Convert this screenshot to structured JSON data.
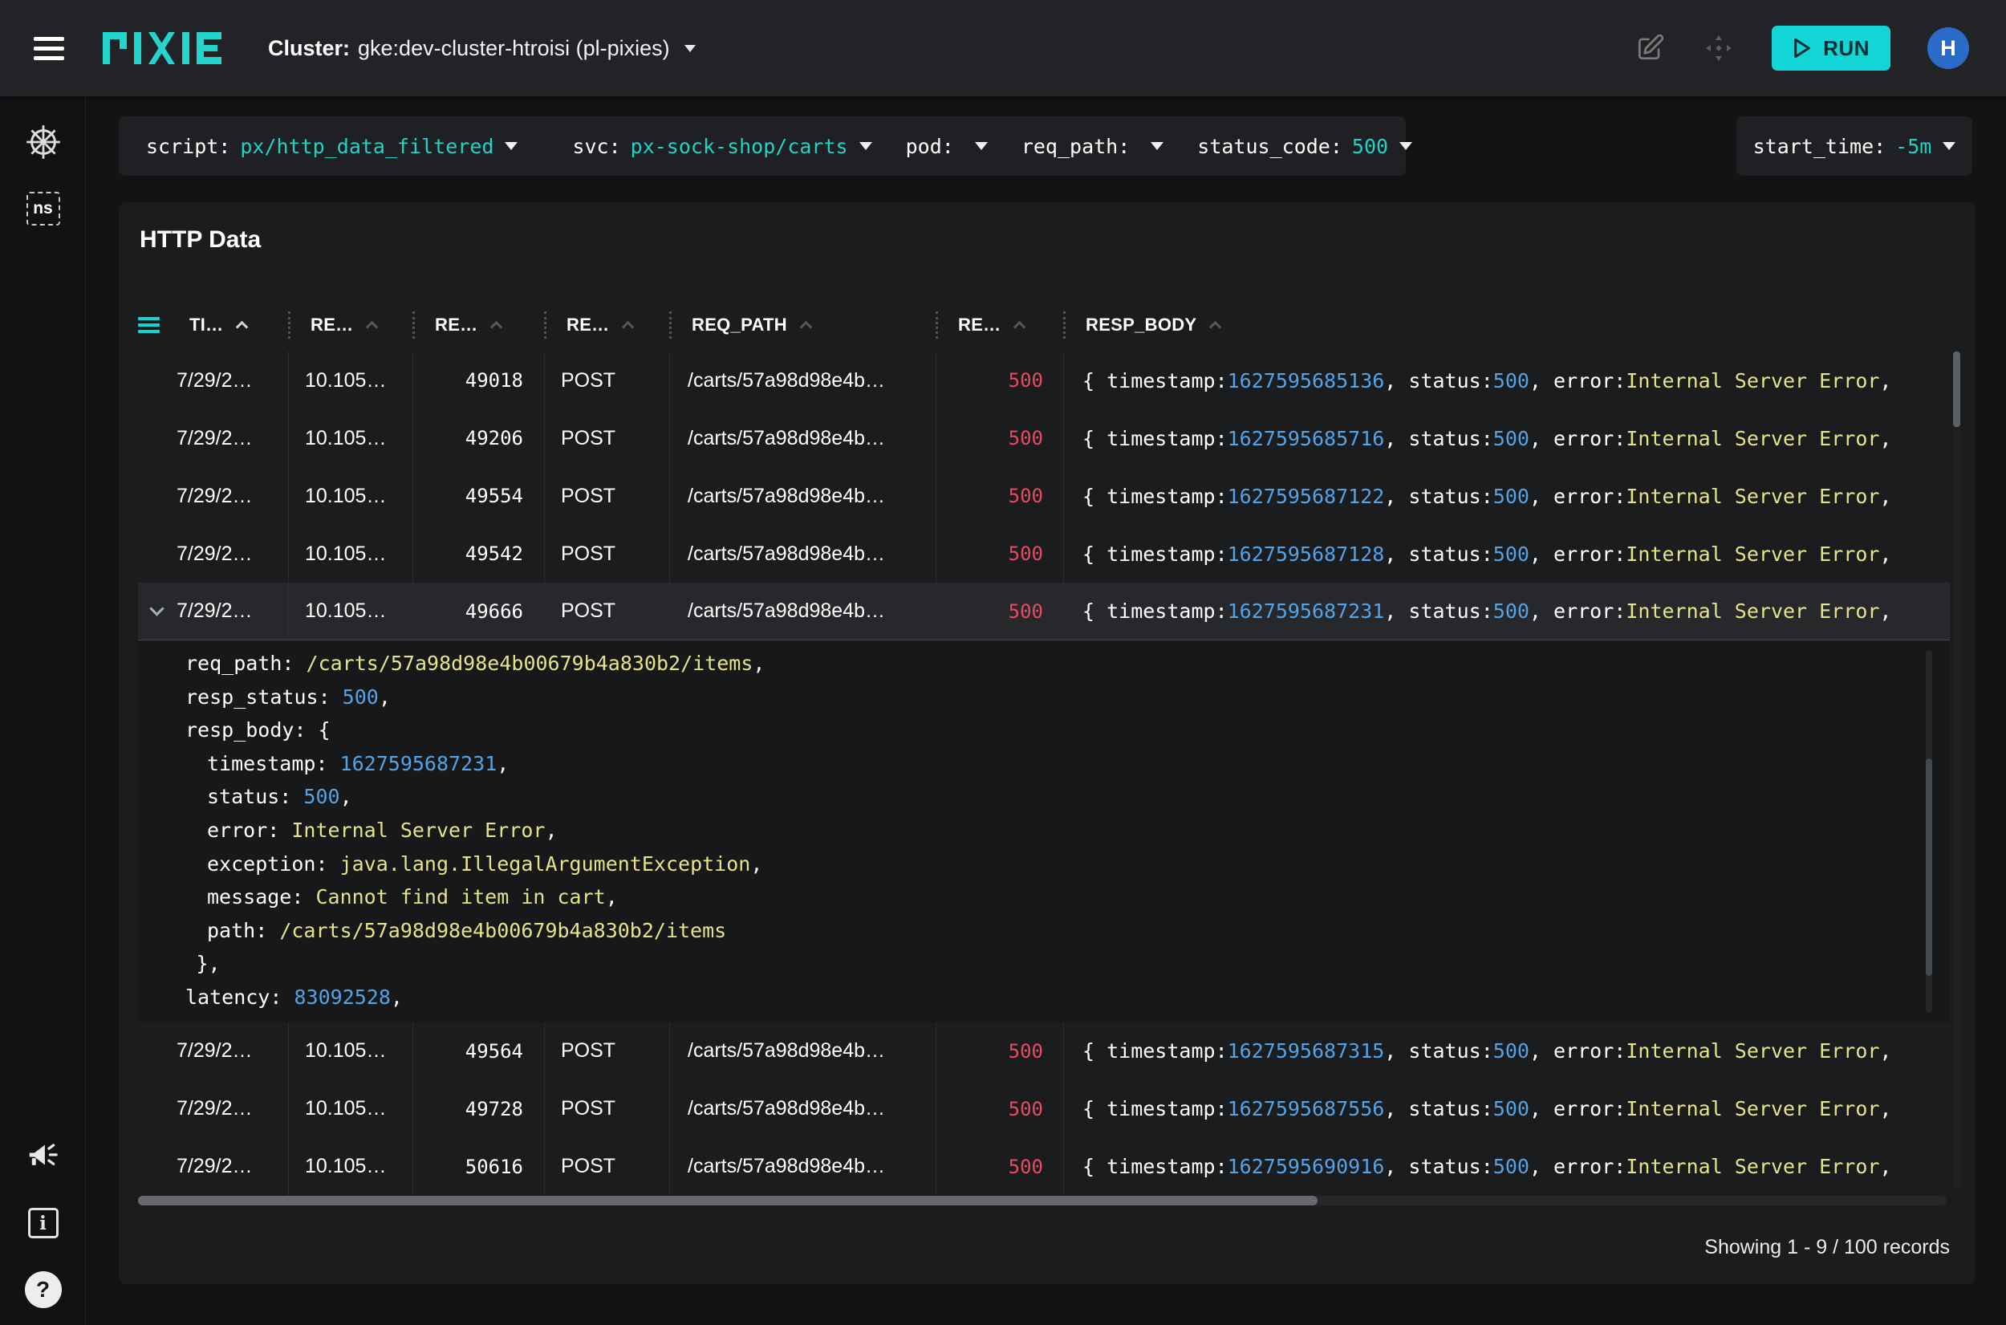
{
  "topbar": {
    "logo_text": "PIXIE",
    "cluster_label": "Cluster:",
    "cluster_value": "gke:dev-cluster-htroisi (pl-pixies)",
    "run_label": "RUN",
    "avatar_initial": "H"
  },
  "colors": {
    "accent_teal": "#12d6d6",
    "status_error_red": "#ee4860",
    "number_blue": "#53a3e6",
    "string_yellow": "#e6e287",
    "avatar_blue": "#2b6cc8"
  },
  "sidebar": {
    "ns_label": "ns"
  },
  "script_bar": {
    "fields": [
      {
        "label": "script:",
        "value": "px/http_data_filtered"
      },
      {
        "label": "svc:",
        "value": "px-sock-shop/carts"
      },
      {
        "label": "pod:",
        "value": ""
      },
      {
        "label": "req_path:",
        "value": ""
      },
      {
        "label": "status_code:",
        "value": "500"
      }
    ],
    "start_time_label": "start_time:",
    "start_time_value": "-5m"
  },
  "table": {
    "title": "HTTP Data",
    "columns": [
      "TI…",
      "RE…",
      "RE…",
      "RE…",
      "REQ_PATH",
      "RE…",
      "RESP_BODY"
    ],
    "footer": "Showing 1 - 9 / 100 records",
    "rows": [
      {
        "time": "7/29/2…",
        "addr": "10.105…",
        "port": "49018",
        "method": "POST",
        "path": "/carts/57a98d98e4b…",
        "status": "500",
        "selected": false,
        "body": [
          [
            "{ timestamp: ",
            "p"
          ],
          [
            "1627595685136",
            "n"
          ],
          [
            ", status: ",
            "p"
          ],
          [
            "500",
            "n"
          ],
          [
            ", error: ",
            "p"
          ],
          [
            "Internal Server Error",
            "s"
          ],
          [
            ",",
            "p"
          ]
        ]
      },
      {
        "time": "7/29/2…",
        "addr": "10.105…",
        "port": "49206",
        "method": "POST",
        "path": "/carts/57a98d98e4b…",
        "status": "500",
        "selected": false,
        "body": [
          [
            "{ timestamp: ",
            "p"
          ],
          [
            "1627595685716",
            "n"
          ],
          [
            ", status: ",
            "p"
          ],
          [
            "500",
            "n"
          ],
          [
            ", error: ",
            "p"
          ],
          [
            "Internal Server Error",
            "s"
          ],
          [
            ",",
            "p"
          ]
        ]
      },
      {
        "time": "7/29/2…",
        "addr": "10.105…",
        "port": "49554",
        "method": "POST",
        "path": "/carts/57a98d98e4b…",
        "status": "500",
        "selected": false,
        "body": [
          [
            "{ timestamp: ",
            "p"
          ],
          [
            "1627595687122",
            "n"
          ],
          [
            ", status: ",
            "p"
          ],
          [
            "500",
            "n"
          ],
          [
            ", error: ",
            "p"
          ],
          [
            "Internal Server Error",
            "s"
          ],
          [
            ",",
            "p"
          ]
        ]
      },
      {
        "time": "7/29/2…",
        "addr": "10.105…",
        "port": "49542",
        "method": "POST",
        "path": "/carts/57a98d98e4b…",
        "status": "500",
        "selected": false,
        "body": [
          [
            "{ timestamp: ",
            "p"
          ],
          [
            "1627595687128",
            "n"
          ],
          [
            ", status: ",
            "p"
          ],
          [
            "500",
            "n"
          ],
          [
            ", error: ",
            "p"
          ],
          [
            "Internal Server Error",
            "s"
          ],
          [
            ",",
            "p"
          ]
        ]
      },
      {
        "time": "7/29/2…",
        "addr": "10.105…",
        "port": "49666",
        "method": "POST",
        "path": "/carts/57a98d98e4b…",
        "status": "500",
        "selected": true,
        "body": [
          [
            "{ timestamp: ",
            "p"
          ],
          [
            "1627595687231",
            "n"
          ],
          [
            ", status: ",
            "p"
          ],
          [
            "500",
            "n"
          ],
          [
            ", error: ",
            "p"
          ],
          [
            "Internal Server Error",
            "s"
          ],
          [
            ",",
            "p"
          ]
        ]
      },
      {
        "time": "7/29/2…",
        "addr": "10.105…",
        "port": "49564",
        "method": "POST",
        "path": "/carts/57a98d98e4b…",
        "status": "500",
        "selected": false,
        "body": [
          [
            "{ timestamp: ",
            "p"
          ],
          [
            "1627595687315",
            "n"
          ],
          [
            ", status: ",
            "p"
          ],
          [
            "500",
            "n"
          ],
          [
            ", error: ",
            "p"
          ],
          [
            "Internal Server Error",
            "s"
          ],
          [
            ",",
            "p"
          ]
        ]
      },
      {
        "time": "7/29/2…",
        "addr": "10.105…",
        "port": "49728",
        "method": "POST",
        "path": "/carts/57a98d98e4b…",
        "status": "500",
        "selected": false,
        "body": [
          [
            "{ timestamp: ",
            "p"
          ],
          [
            "1627595687556",
            "n"
          ],
          [
            ", status: ",
            "p"
          ],
          [
            "500",
            "n"
          ],
          [
            ", error: ",
            "p"
          ],
          [
            "Internal Server Error",
            "s"
          ],
          [
            ",",
            "p"
          ]
        ]
      },
      {
        "time": "7/29/2…",
        "addr": "10.105…",
        "port": "50616",
        "method": "POST",
        "path": "/carts/57a98d98e4b…",
        "status": "500",
        "selected": false,
        "body": [
          [
            "{ timestamp: ",
            "p"
          ],
          [
            "1627595690916",
            "n"
          ],
          [
            ", status: ",
            "p"
          ],
          [
            "500",
            "n"
          ],
          [
            ", error: ",
            "p"
          ],
          [
            "Internal Server Error",
            "s"
          ],
          [
            ",",
            "p"
          ]
        ]
      }
    ]
  },
  "detail": {
    "lines": [
      {
        "indent": 0,
        "segs": [
          [
            "req_path: ",
            "k"
          ],
          [
            "/carts/57a98d98e4b00679b4a830b2/items",
            "s"
          ],
          [
            ",",
            "p"
          ]
        ]
      },
      {
        "indent": 0,
        "segs": [
          [
            "resp_status: ",
            "k"
          ],
          [
            "500",
            "n"
          ],
          [
            ",",
            "p"
          ]
        ]
      },
      {
        "indent": 0,
        "segs": [
          [
            "resp_body: {",
            "k"
          ]
        ]
      },
      {
        "indent": 1,
        "segs": [
          [
            "timestamp: ",
            "k"
          ],
          [
            "1627595687231",
            "n"
          ],
          [
            ",",
            "p"
          ]
        ]
      },
      {
        "indent": 1,
        "segs": [
          [
            "status: ",
            "k"
          ],
          [
            "500",
            "n"
          ],
          [
            ",",
            "p"
          ]
        ]
      },
      {
        "indent": 1,
        "segs": [
          [
            "error: ",
            "k"
          ],
          [
            "Internal Server Error",
            "s"
          ],
          [
            ",",
            "p"
          ]
        ]
      },
      {
        "indent": 1,
        "segs": [
          [
            "exception: ",
            "k"
          ],
          [
            "java.lang.IllegalArgumentException",
            "s"
          ],
          [
            ",",
            "p"
          ]
        ]
      },
      {
        "indent": 1,
        "segs": [
          [
            "message: ",
            "k"
          ],
          [
            "Cannot find item in cart",
            "s"
          ],
          [
            ",",
            "p"
          ]
        ]
      },
      {
        "indent": 1,
        "segs": [
          [
            "path: ",
            "k"
          ],
          [
            "/carts/57a98d98e4b00679b4a830b2/items",
            "s"
          ]
        ]
      },
      {
        "indent": 0.5,
        "segs": [
          [
            "},",
            "k"
          ]
        ]
      },
      {
        "indent": 0,
        "segs": [
          [
            "latency: ",
            "k"
          ],
          [
            "83092528",
            "n"
          ],
          [
            ",",
            "p"
          ]
        ]
      }
    ]
  }
}
